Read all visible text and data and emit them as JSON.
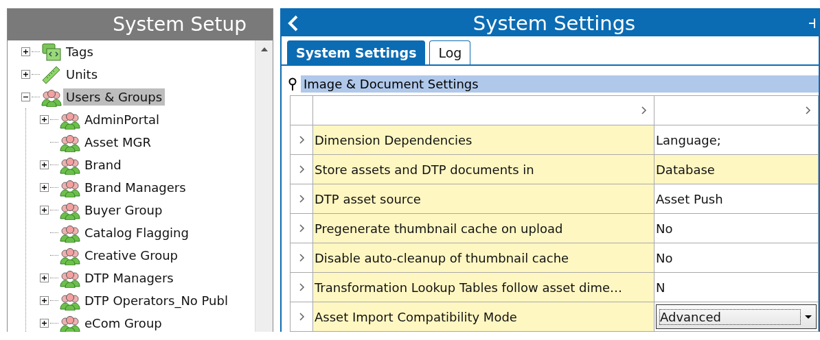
{
  "left_panel": {
    "title": "System Setup",
    "tree": [
      {
        "label": "Tags",
        "kind": "folder",
        "expanded": false,
        "selected": false
      },
      {
        "label": "Units",
        "kind": "ruler",
        "expanded": false,
        "selected": false
      },
      {
        "label": "Users & Groups",
        "kind": "group",
        "expanded": true,
        "selected": true,
        "children": [
          {
            "label": "AdminPortal",
            "kind": "group",
            "expanded": false,
            "selected": false
          },
          {
            "label": "Asset MGR",
            "kind": "group",
            "selected": false
          },
          {
            "label": "Brand",
            "kind": "group",
            "expanded": false,
            "selected": false
          },
          {
            "label": "Brand Managers",
            "kind": "group",
            "expanded": false,
            "selected": false
          },
          {
            "label": "Buyer Group",
            "kind": "group",
            "expanded": false,
            "selected": false
          },
          {
            "label": "Catalog Flagging",
            "kind": "group",
            "selected": false
          },
          {
            "label": "Creative Group",
            "kind": "group",
            "selected": false
          },
          {
            "label": "DTP Managers",
            "kind": "group",
            "expanded": false,
            "selected": false
          },
          {
            "label": "DTP Operators_No Publ",
            "kind": "group",
            "expanded": false,
            "selected": false
          },
          {
            "label": "eCom Group",
            "kind": "group",
            "expanded": false,
            "selected": false
          }
        ]
      }
    ]
  },
  "right_panel": {
    "title": "System Settings",
    "tabs": [
      {
        "label": "System Settings",
        "selected": true
      },
      {
        "label": "Log",
        "selected": false
      }
    ],
    "group": {
      "title": "Image & Document Settings"
    },
    "table": {
      "rows": [
        {
          "name": "Dimension Dependencies",
          "value": "Language;",
          "kind": "text",
          "highlighted": false
        },
        {
          "name": "Store assets and DTP documents in",
          "value": "Database",
          "kind": "text",
          "highlighted": true
        },
        {
          "name": "DTP asset source",
          "value": "Asset Push",
          "kind": "text",
          "highlighted": false
        },
        {
          "name": "Pregenerate thumbnail cache on upload",
          "value": "No",
          "kind": "text",
          "highlighted": false
        },
        {
          "name": "Disable auto-cleanup of thumbnail cache",
          "value": "No",
          "kind": "text",
          "highlighted": false
        },
        {
          "name": "Transformation Lookup Tables follow asset dime…",
          "value": "N",
          "kind": "text",
          "highlighted": false
        },
        {
          "name": "Asset Import Compatibility Mode",
          "value": "Advanced",
          "kind": "dropdown",
          "highlighted": false
        }
      ]
    }
  }
}
